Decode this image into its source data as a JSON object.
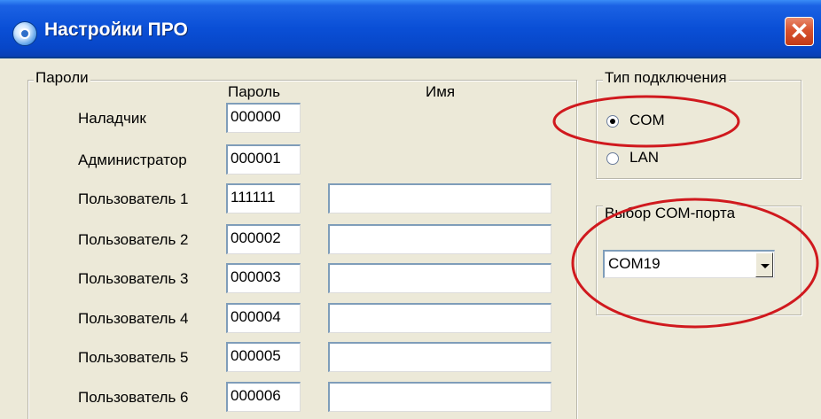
{
  "window": {
    "title": "Настройки ПРО",
    "close_label": "✕"
  },
  "passwords": {
    "legend": "Пароли",
    "col_password": "Пароль",
    "col_name": "Имя",
    "rows": [
      {
        "label": "Наладчик",
        "password": "000000",
        "name": null
      },
      {
        "label": "Администратор",
        "password": "000001",
        "name": null
      },
      {
        "label": "Пользователь 1",
        "password": "111111",
        "name": ""
      },
      {
        "label": "Пользователь 2",
        "password": "000002",
        "name": ""
      },
      {
        "label": "Пользователь 3",
        "password": "000003",
        "name": ""
      },
      {
        "label": "Пользователь 4",
        "password": "000004",
        "name": ""
      },
      {
        "label": "Пользователь 5",
        "password": "000005",
        "name": ""
      },
      {
        "label": "Пользователь 6",
        "password": "000006",
        "name": ""
      }
    ]
  },
  "connection": {
    "legend": "Тип подключения",
    "options": [
      {
        "label": "COM",
        "checked": true
      },
      {
        "label": "LAN",
        "checked": false
      }
    ]
  },
  "com_port": {
    "legend": "Выбор COM-порта",
    "selected": "COM19"
  },
  "colors": {
    "annotation": "#d0191e",
    "titlebar": "#0a4fd6",
    "dialog_bg": "#ece9d8"
  }
}
